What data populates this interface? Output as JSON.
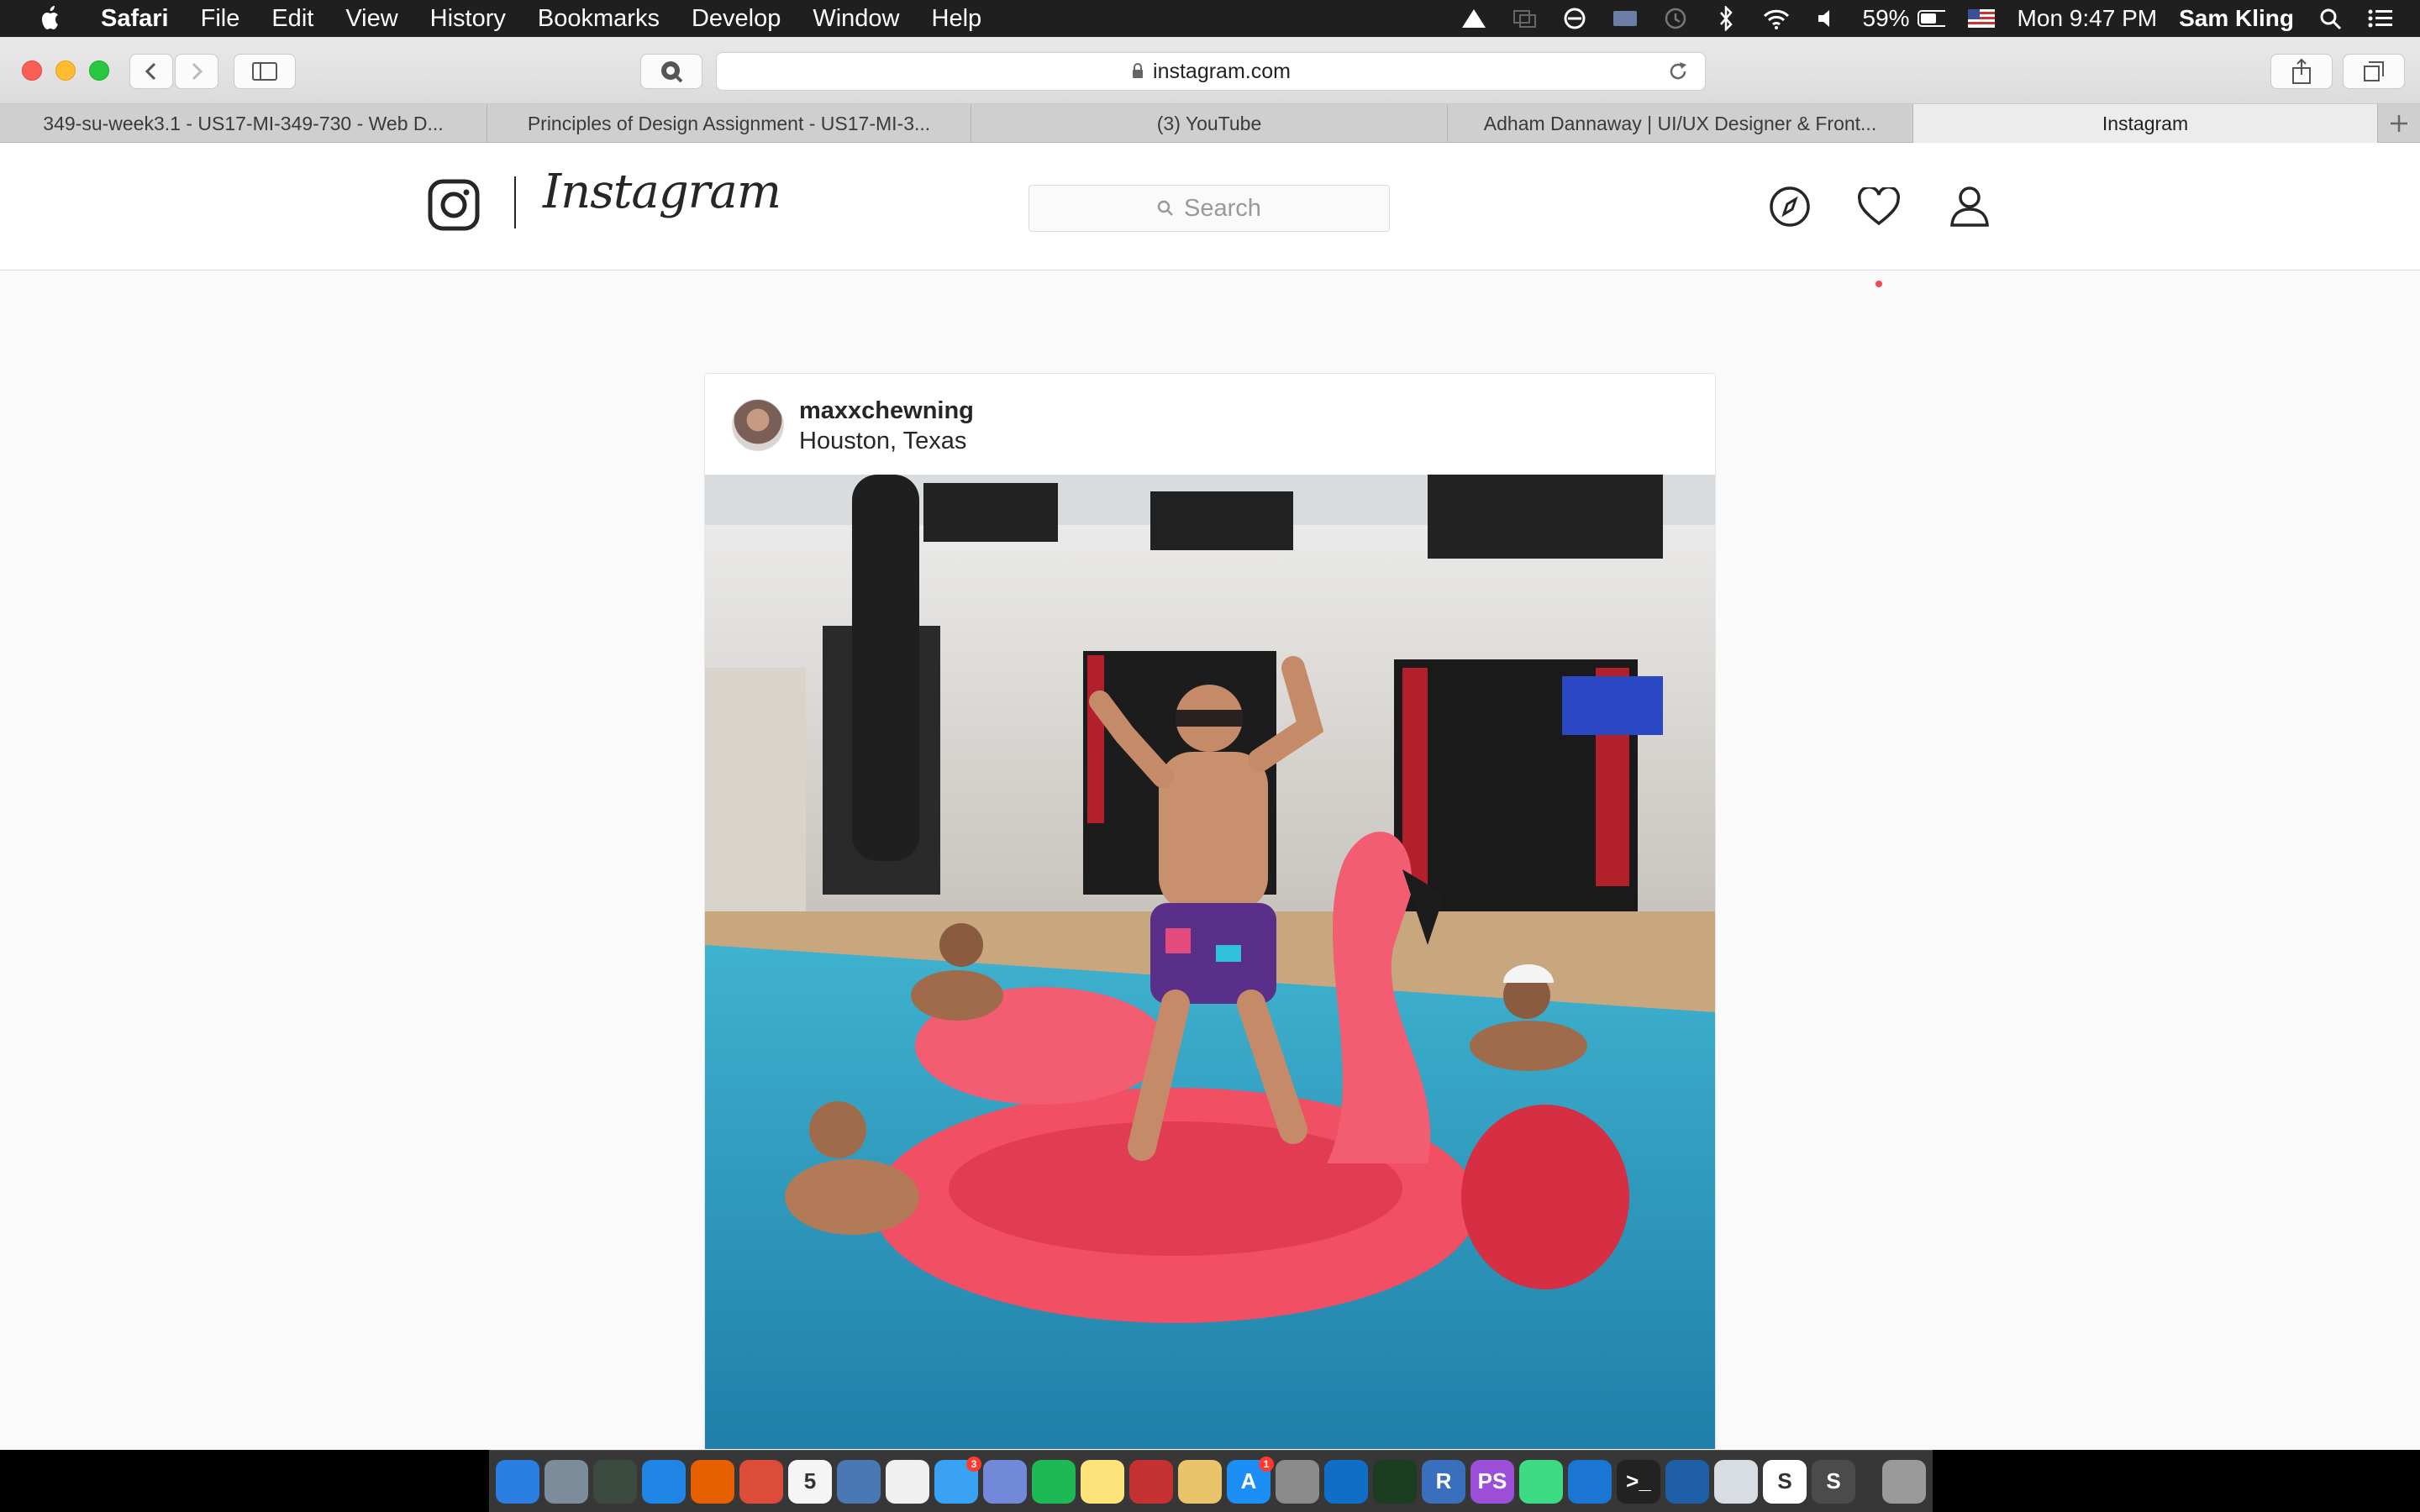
{
  "menubar": {
    "app_name": "Safari",
    "menus": [
      "File",
      "Edit",
      "View",
      "History",
      "Bookmarks",
      "Develop",
      "Window",
      "Help"
    ],
    "battery": "59%",
    "clock": "Mon 9:47 PM",
    "user": "Sam Kling"
  },
  "browser": {
    "url": "instagram.com",
    "tabs": [
      {
        "label": "349-su-week3.1 - US17-MI-349-730 - Web D...",
        "active": false
      },
      {
        "label": "Principles of Design Assignment - US17-MI-3...",
        "active": false
      },
      {
        "label": "(3) YouTube",
        "active": false
      },
      {
        "label": "Adham Dannaway | UI/UX Designer & Front...",
        "active": false
      },
      {
        "label": "Instagram",
        "active": true
      }
    ]
  },
  "instagram": {
    "wordmark": "Instagram",
    "search_placeholder": "Search",
    "post": {
      "username": "maxxchewning",
      "location": "Houston, Texas"
    }
  },
  "dock": {
    "items": [
      {
        "name": "finder-icon",
        "color": "#2a7de1",
        "glyph": ""
      },
      {
        "name": "launchpad-icon",
        "color": "#7d8c9a",
        "glyph": ""
      },
      {
        "name": "mission-control-icon",
        "color": "#3b4a3e",
        "glyph": ""
      },
      {
        "name": "safari-icon",
        "color": "#1f86e6",
        "glyph": ""
      },
      {
        "name": "firefox-icon",
        "color": "#e66000",
        "glyph": ""
      },
      {
        "name": "chrome-icon",
        "color": "#dd4b39",
        "glyph": ""
      },
      {
        "name": "calendar-icon",
        "color": "#f5f5f5",
        "glyph": "5"
      },
      {
        "name": "preview-icon",
        "color": "#4a78b5",
        "glyph": ""
      },
      {
        "name": "itunes-icon",
        "color": "#f0f0f0",
        "glyph": ""
      },
      {
        "name": "messages-icon",
        "color": "#39a2f5",
        "glyph": "",
        "badge": "3"
      },
      {
        "name": "discord-icon",
        "color": "#7289da",
        "glyph": ""
      },
      {
        "name": "spotify-icon",
        "color": "#1db954",
        "glyph": ""
      },
      {
        "name": "notes-icon",
        "color": "#fde47a",
        "glyph": ""
      },
      {
        "name": "photo-booth-icon",
        "color": "#c53030",
        "glyph": ""
      },
      {
        "name": "image-capture-icon",
        "color": "#e9c46a",
        "glyph": ""
      },
      {
        "name": "app-store-icon",
        "color": "#1b8ff5",
        "glyph": "A",
        "badge": "1"
      },
      {
        "name": "system-preferences-icon",
        "color": "#8b8b8b",
        "glyph": ""
      },
      {
        "name": "vscode-icon",
        "color": "#0f6fc6",
        "glyph": ""
      },
      {
        "name": "activity-ring-icon",
        "color": "#1a3d1f",
        "glyph": ""
      },
      {
        "name": "r-icon",
        "color": "#3a6fbd",
        "glyph": "R"
      },
      {
        "name": "phpstorm-icon",
        "color": "#9b4fd8",
        "glyph": "PS"
      },
      {
        "name": "android-studio-icon",
        "color": "#3ddc84",
        "glyph": ""
      },
      {
        "name": "xcode-icon",
        "color": "#1b76d3",
        "glyph": ""
      },
      {
        "name": "terminal-icon",
        "color": "#222222",
        "glyph": ">_"
      },
      {
        "name": "virtualbox-icon",
        "color": "#1f5fa8",
        "glyph": ""
      },
      {
        "name": "script-editor-icon",
        "color": "#d7dde2",
        "glyph": ""
      },
      {
        "name": "slack-icon",
        "color": "#ffffff",
        "glyph": "S"
      },
      {
        "name": "sublime-icon",
        "color": "#4b4b4b",
        "glyph": "S"
      },
      {
        "name": "trash-icon",
        "color": "#9a9a9a",
        "glyph": ""
      }
    ]
  }
}
